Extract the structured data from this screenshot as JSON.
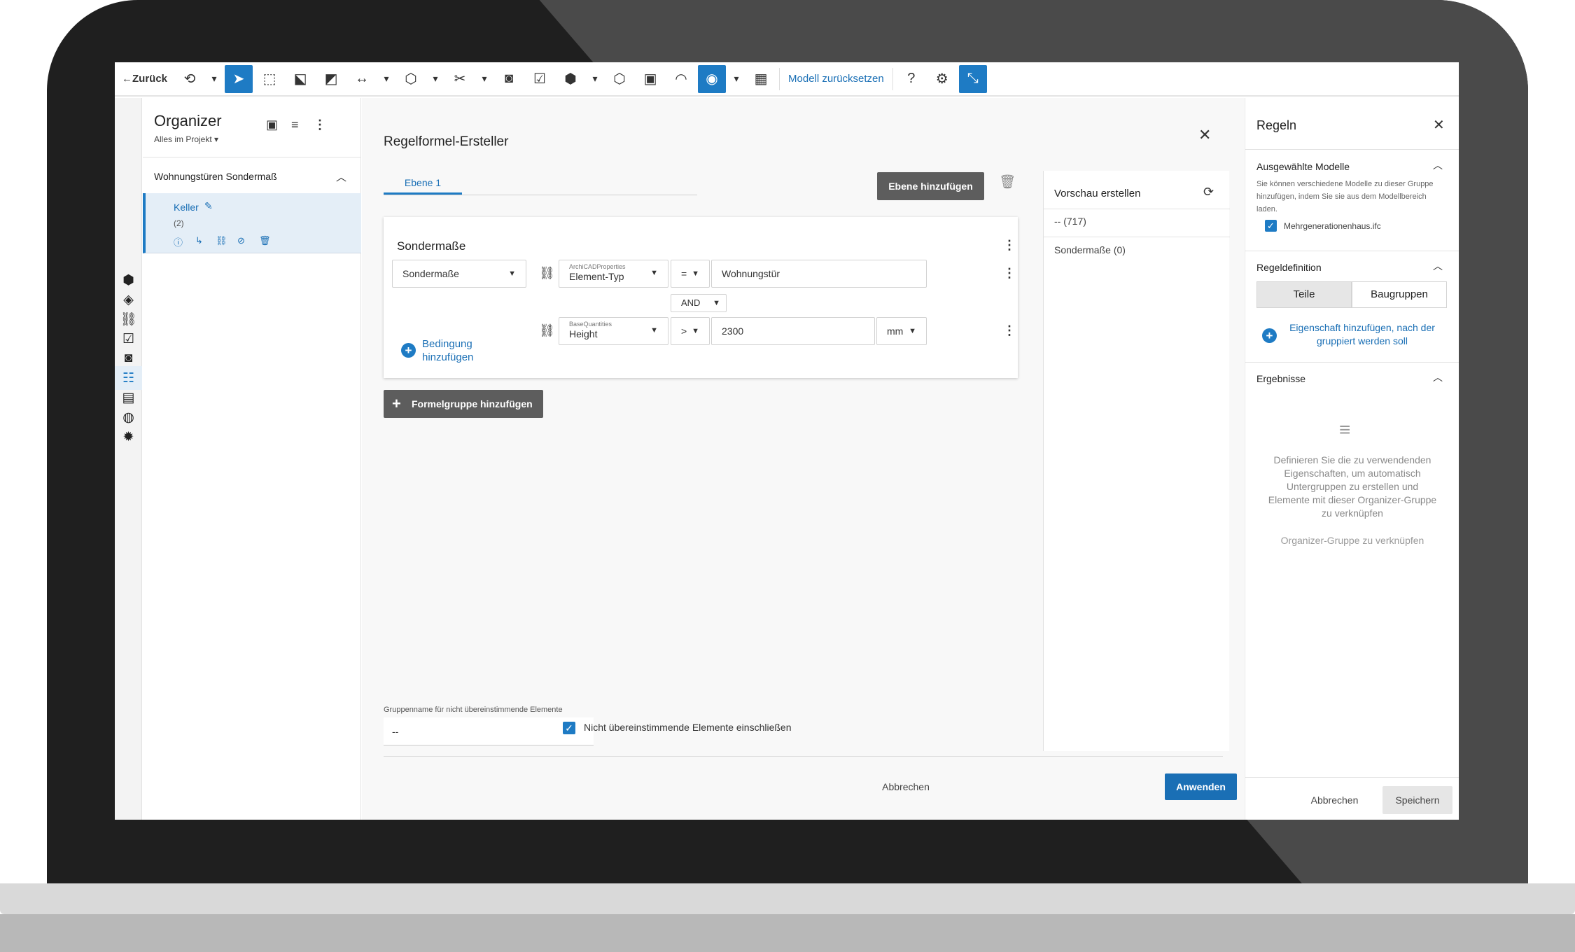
{
  "toolbar": {
    "back_label": "Zurück",
    "reset_label": "Modell zurücksetzen"
  },
  "organizer": {
    "title": "Organizer",
    "scope": "Alles im Projekt",
    "group": "Wohnungstüren Sondermaß",
    "item": {
      "name": "Keller",
      "count": "(2)"
    }
  },
  "rule_builder": {
    "title": "Regelformel-Ersteller",
    "tab_label": "Ebene 1",
    "add_level_label": "Ebene hinzufügen",
    "card_title": "Sondermaße",
    "condition1": {
      "group_select": "Sondermaße",
      "property_set": "ArchiCADProperties",
      "property": "Element-Typ",
      "operator": "=",
      "value": "Wohnungstür"
    },
    "logic_operator": "AND",
    "condition2": {
      "add_label": "Bedingung hinzufügen",
      "property_set": "BaseQuantities",
      "property": "Height",
      "operator": ">",
      "value": "2300",
      "unit": "mm"
    },
    "add_formula_group_label": "Formelgruppe hinzufügen",
    "nomatch_label": "Gruppenname für nicht übereinstimmende Elemente",
    "nomatch_value": "--",
    "include_nomatch_label": "Nicht übereinstimmende Elemente einschließen",
    "include_nomatch_checked": true,
    "cancel_label": "Abbrechen",
    "apply_label": "Anwenden"
  },
  "preview": {
    "title": "Vorschau erstellen",
    "rows": [
      "-- (717)",
      "Sondermaße (0)"
    ]
  },
  "rules_panel": {
    "title": "Regeln",
    "models_section": "Ausgewählte Modelle",
    "models_hint": "Sie können verschiedene Modelle zu dieser Gruppe hinzufügen, indem Sie sie aus dem Modellbereich laden.",
    "model_file": "Mehrgenerationenhaus.ifc",
    "definition_section": "Regeldefinition",
    "toggle_parts": "Teile",
    "toggle_assemblies": "Baugruppen",
    "add_property_label": "Eigenschaft hinzufügen, nach der gruppiert werden soll",
    "results_section": "Ergebnisse",
    "results_hint": "Definieren Sie die zu verwendenden Eigenschaften, um automatisch Untergruppen zu erstellen und Elemente mit dieser Organizer-Gruppe zu verknüpfen",
    "results_link": "Organizer-Gruppe zu verknüpfen",
    "cancel_label": "Abbrechen",
    "save_label": "Speichern"
  },
  "colors": {
    "accent": "#1e7bc4",
    "link": "#1a6fb5",
    "dark_button": "#5d5d5d"
  }
}
